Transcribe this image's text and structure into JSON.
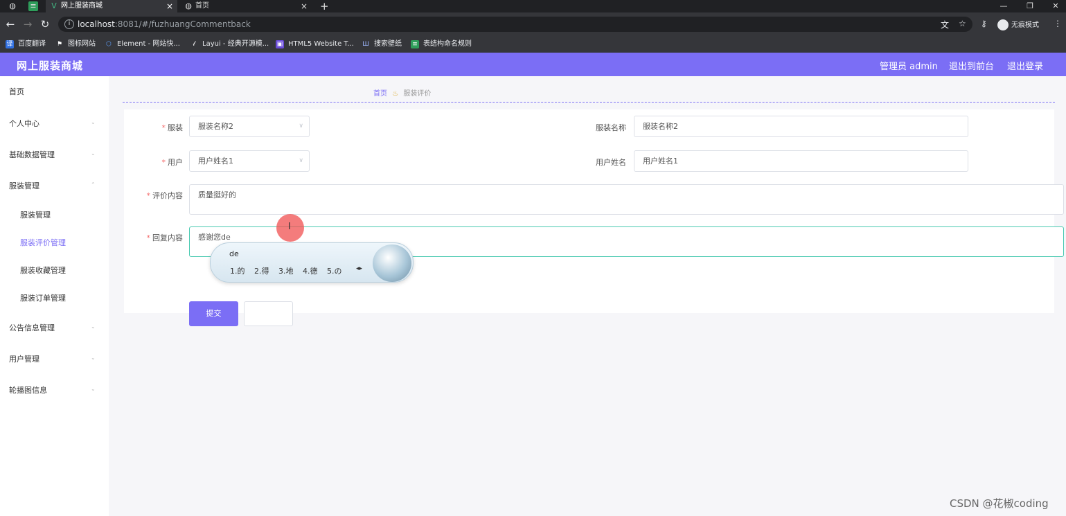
{
  "browser": {
    "tabs": [
      {
        "label": "网上服装商城",
        "active": true
      },
      {
        "label": "首页",
        "active": false
      }
    ],
    "new_tab": "+",
    "url_host": "localhost",
    "url_rest": ":8081/#/fuzhuangCommentback",
    "incognito_label": "无痕模式",
    "bookmarks": [
      "百度翻译",
      "图标网站",
      "Element - 网站快...",
      "Layui - 经典开源模...",
      "HTML5 Website T...",
      "搜索壁纸",
      "表结构命名规则"
    ]
  },
  "header": {
    "title": "网上服装商城",
    "admin": "管理员 admin",
    "front": "退出到前台",
    "logout": "退出登录",
    "color": "#7b6ef5"
  },
  "sidebar": {
    "items": [
      "首页",
      "个人中心",
      "基础数据管理",
      "服装管理",
      "公告信息管理",
      "用户管理",
      "轮播图信息"
    ],
    "sub_items": [
      "服装管理",
      "服装评价管理",
      "服装收藏管理",
      "服装订单管理"
    ],
    "active_sub": "服装评价管理"
  },
  "breadcrumb": {
    "home": "首页",
    "current": "服装评价"
  },
  "form": {
    "fuzhuang_label": "服装",
    "fuzhuang_value": "服装名称2",
    "fuzhuang_name_label": "服装名称",
    "fuzhuang_name_value": "服装名称2",
    "user_label": "用户",
    "user_value": "用户姓名1",
    "user_name_label": "用户姓名",
    "user_name_value": "用户姓名1",
    "comment_label": "评价内容",
    "comment_value": "质量挺好的",
    "reply_label": "回复内容",
    "reply_value": "感谢您de",
    "submit": "提交",
    "required_mark": "*"
  },
  "ime": {
    "composition": "de",
    "candidates": "1.的 2.得 3.地 4.德 5.の"
  },
  "watermark": "CSDN @花椒coding"
}
